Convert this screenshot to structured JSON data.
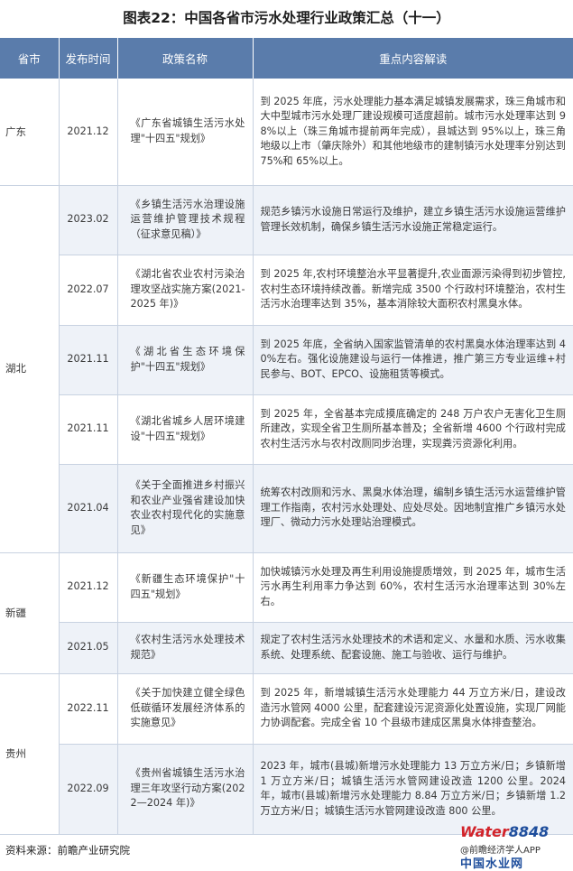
{
  "title": "图表22：中国各省市污水处理行业政策汇总（十一）",
  "headers": [
    "省市",
    "发布时间",
    "政策名称",
    "重点内容解读"
  ],
  "rows": [
    {
      "province": "广东",
      "province_rows": 1,
      "date": "2021.12",
      "policy": "《广东省城镇生活污水处理\"十四五\"规划》",
      "content": "到 2025 年底，污水处理能力基本满足城镇发展需求，珠三角城市和大中型城市污水处理厂建设规模可适度超前。城市污水处理率达到 98%以上（珠三角城市提前两年完成），县城达到 95%以上，珠三角地级以上市（肇庆除外）和其他地级市的建制镇污水处理率分别达到 75%和 65%以上。",
      "h": 118
    },
    {
      "province": "湖北",
      "province_rows": 5,
      "date": "2023.02",
      "policy": "《乡镇生活污水治理设施运营维护管理技术规程（征求意见稿）》",
      "content": "规范乡镇污水设施日常运行及维护，建立乡镇生活污水设施运营维护管理长效机制，确保乡镇生活污水设施正常稳定运行。",
      "h": 77
    },
    {
      "province": "",
      "province_rows": 0,
      "date": "2022.07",
      "policy": "《湖北省农业农村污染治理攻坚战实施方案(2021-2025 年)》",
      "content": "到 2025 年,农村环境整治水平显著提升,农业面源污染得到初步管控,农村生态环境持续改善。新增完成 3500 个行政村环境整治，农村生活污水治理率达到 35%，基本消除较大面积农村黑臭水体。",
      "h": 78
    },
    {
      "province": "",
      "province_rows": 0,
      "date": "2021.11",
      "policy": "《湖北省生态环境保护\"十四五\"规划》",
      "content": "到 2025 年底，全省纳入国家监管清单的农村黑臭水体治理率达到 40%左右。强化设施建设与运行一体推进，推广第三方专业运维+村民参与、BOT、EPCO、设施租赁等模式。",
      "h": 77
    },
    {
      "province": "",
      "province_rows": 0,
      "date": "2021.11",
      "policy": "《湖北省城乡人居环境建设\"十四五\"规划》",
      "content": "到 2025 年，全省基本完成摸底确定的 248 万户农户无害化卫生厕所建改，实现全省卫生厕所基本普及；全省新增 4600 个行政村完成农村生活污水与农村改厕同步治理，实现粪污资源化利用。",
      "h": 77
    },
    {
      "province": "",
      "province_rows": 0,
      "date": "2021.04",
      "policy": "《关于全面推进乡村振兴和农业产业强省建设加快农业农村现代化的实施意见》",
      "content": "统筹农村改厕和污水、黑臭水体治理，编制乡镇生活污水运营维护管理工作指南，农村污水处理处、应处尽处。因地制宜推广乡镇污水处理厂、微动力污水处理站治理模式。",
      "h": 98
    },
    {
      "province": "新疆",
      "province_rows": 2,
      "date": "2021.12",
      "policy": "《新疆生态环境保护\"十四五\"规划》",
      "content": "加快城镇污水处理及再生利用设施提质增效，到 2025 年，城市生活污水再生利用率力争达到 60%，农村生活污水治理率达到 30%左右。",
      "h": 77
    },
    {
      "province": "",
      "province_rows": 0,
      "date": "2021.05",
      "policy": "《农村生活污水处理技术规范》",
      "content": "规定了农村生活污水处理技术的术语和定义、水量和水质、污水收集系统、处理系统、配套设施、施工与验收、运行与维护。",
      "h": 57
    },
    {
      "province": "贵州",
      "province_rows": 2,
      "date": "2022.11",
      "policy": "《关于加快建立健全绿色低碳循环发展经济体系的实施意见》",
      "content": "到 2025 年，新增城镇生活污水处理能力 44 万立方米/日，建设改造污水管网 4000 公里，配套建设污泥资源化处置设施，实现厂网能力协调配套。完成全省 10 个县级市建成区黑臭水体排查整治。",
      "h": 78
    },
    {
      "province": "",
      "province_rows": 0,
      "date": "2022.09",
      "policy": "《贵州省城镇生活污水治理三年攻坚行动方案(2022—2024 年)》",
      "content": "2023 年，城市(县城)新增污水处理能力 13 万立方米/日；乡镇新增 1 万立方米/日；城镇生活污水管网建设改造 1200 公里。2024 年，城市(县城)新增污水处理能力 8.84 万立方米/日；乡镇新增 1.2 万立方米/日；城镇生活污水管网建设改造 800 公里。",
      "h": 100
    }
  ],
  "source": "资料来源：前瞻产业研究院",
  "watermark": {
    "brand_a": "Water",
    "brand_b": "8848",
    "sub": "@前瞻经济学人APP",
    "cn": "中国水业网"
  }
}
